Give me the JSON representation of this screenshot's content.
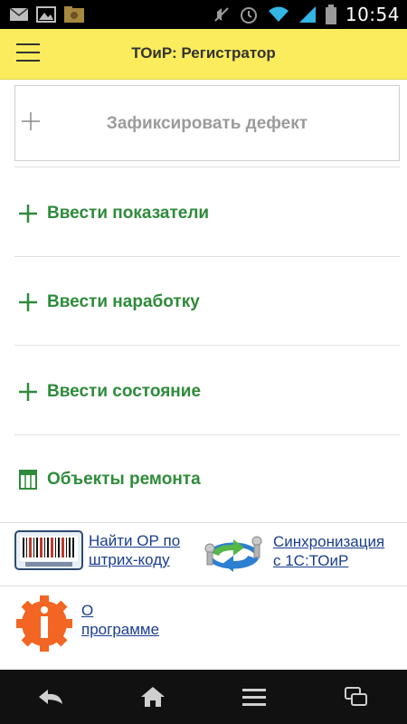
{
  "status_bar": {
    "time": "10:54",
    "icons": [
      "mail-icon",
      "image-icon",
      "folder-icon",
      "mute-icon",
      "alarm-icon",
      "wifi-icon",
      "signal-icon",
      "battery-icon"
    ]
  },
  "app_bar": {
    "title": "ТОиР: Регистратор",
    "menu_icon": "hamburger-menu-icon"
  },
  "main": {
    "defect_button": {
      "label": "Зафиксировать дефект",
      "icon": "plus-icon"
    },
    "actions": [
      {
        "label": "Ввести показатели",
        "icon": "plus-icon"
      },
      {
        "label": "Ввести наработку",
        "icon": "plus-icon"
      },
      {
        "label": "Ввести состояние",
        "icon": "plus-icon"
      },
      {
        "label": "Объекты ремонта",
        "icon": "table-icon"
      }
    ]
  },
  "links": {
    "barcode": {
      "line1": "Найти ОР по",
      "line2": "штрих-коду",
      "icon": "barcode-icon"
    },
    "sync": {
      "line1": "Синхронизация",
      "line2": "с 1С:ТОиР",
      "icon": "sync-icon"
    },
    "about": {
      "line1": "О",
      "line2": "программе",
      "icon": "info-gear-icon"
    }
  },
  "nav_bar": {
    "buttons": [
      "back-icon",
      "home-icon",
      "menu-icon",
      "recent-apps-icon"
    ]
  },
  "colors": {
    "header": "#fbec5d",
    "action_green": "#2e8b3a",
    "link_blue": "#1a3d8f",
    "about_orange": "#f26522"
  }
}
